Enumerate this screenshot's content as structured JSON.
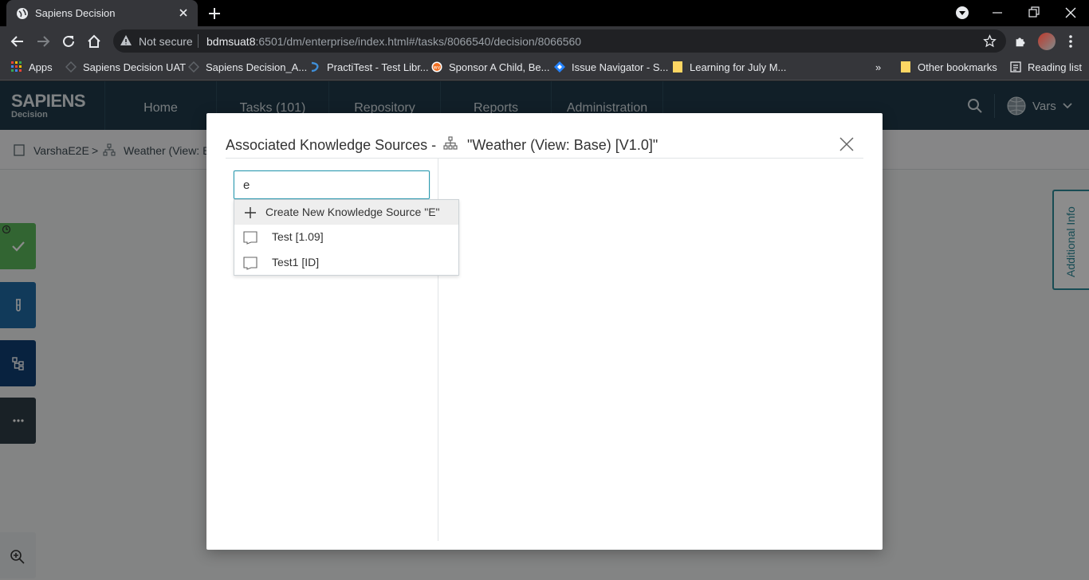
{
  "browser": {
    "tab_title": "Sapiens Decision",
    "omnibox": {
      "security_label": "Not secure",
      "url_host": "bdmsuat8",
      "url_rest": ":6501/dm/enterprise/index.html#/tasks/8066540/decision/8066560"
    },
    "bookmarks": [
      {
        "label": "Apps",
        "icon": "apps-grid-icon"
      },
      {
        "label": "Sapiens Decision UAT",
        "icon": "sapiens-icon"
      },
      {
        "label": "Sapiens Decision_A...",
        "icon": "sapiens-icon"
      },
      {
        "label": "PractiTest - Test Libr...",
        "icon": "practitest-icon"
      },
      {
        "label": "Sponsor A Child, Be...",
        "icon": "wv-icon"
      },
      {
        "label": "Issue Navigator - S...",
        "icon": "jira-icon"
      },
      {
        "label": "Learning for July M...",
        "icon": "folder-icon"
      }
    ],
    "overflow_label": "»",
    "other_bookmarks": "Other bookmarks",
    "reading_list": "Reading list"
  },
  "app": {
    "logo_main": "SAPIENS",
    "logo_sub": "Decision",
    "nav": [
      {
        "label": "Home"
      },
      {
        "label": "Tasks  (101)"
      },
      {
        "label": "Repository"
      },
      {
        "label": "Reports"
      },
      {
        "label": "Administration"
      }
    ],
    "user": "Vars",
    "breadcrumb": {
      "project": "VarshaE2E",
      "separator": ">",
      "item": "Weather (View: B"
    },
    "additional_info": "Additional Info"
  },
  "modal": {
    "title": "Associated Knowledge Sources -",
    "entity": "\"Weather (View: Base) [V1.0]\"",
    "search_value": "e",
    "dropdown": {
      "create_label": "Create New Knowledge Source \"E\"",
      "items": [
        {
          "label": "Test [1.09]"
        },
        {
          "label": "Test1 [ID]"
        }
      ]
    }
  },
  "colors": {
    "nav_bg": "#1f3a4a",
    "accent": "#2e9bb0",
    "approve_green": "#5cb85c",
    "side_blue": "#1f6aa5",
    "side_navy": "#0f3f74",
    "side_dark": "#2f3d46"
  }
}
